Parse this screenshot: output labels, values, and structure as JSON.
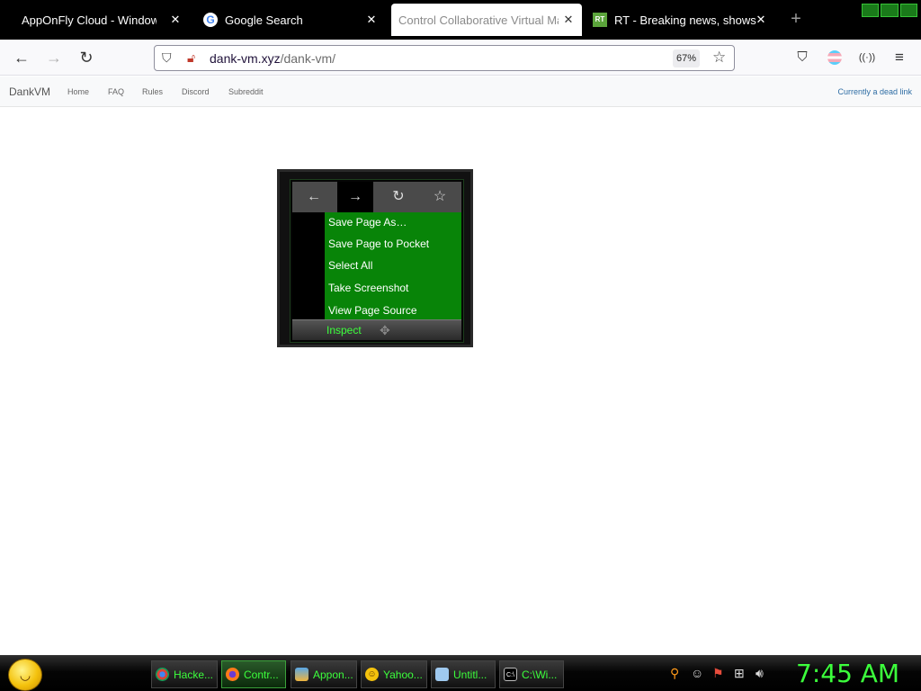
{
  "tabs": [
    {
      "title": "AppOnFly Cloud - Windows V",
      "close": "✕"
    },
    {
      "title": "Google Search",
      "close": "✕"
    },
    {
      "title": "Control Collaborative Virtual Mach",
      "close": "✕"
    },
    {
      "title": "RT - Breaking news, shows, po",
      "close": "✕",
      "favicon_text": "RT"
    }
  ],
  "new_tab": "+",
  "url": {
    "host": "dank-vm.xyz",
    "path": "/dank-vm/",
    "zoom": "67%"
  },
  "toolbar_icons": [
    "back-icon",
    "forward-icon",
    "reload-icon",
    "shield-icon",
    "lock-icon",
    "star-icon",
    "pocket-icon",
    "extension-icon",
    "menu-icon"
  ],
  "site_nav": {
    "brand": "DankVM",
    "links": [
      "Home",
      "FAQ",
      "Rules",
      "Discord",
      "Subreddit"
    ],
    "right_link": "Currently a dead link"
  },
  "vm_context_menu": {
    "items": [
      "Save Page As…",
      "Save Page to Pocket",
      "Select All",
      "Take Screenshot",
      "View Page Source"
    ],
    "hovered_item": "Inspect",
    "menu_color": "#088408"
  },
  "taskbar": {
    "tasks": [
      {
        "label": "Hacke...",
        "icon": "chrome-icon"
      },
      {
        "label": "Contr...",
        "icon": "firefox-icon"
      },
      {
        "label": "Appon...",
        "icon": "apponfly-icon"
      },
      {
        "label": "Yahoo...",
        "icon": "yahoo-icon"
      },
      {
        "label": "Untitl...",
        "icon": "notepad-icon"
      },
      {
        "label": "C:\\Wi...",
        "icon": "cmd-icon"
      }
    ],
    "clock": "7:45 AM",
    "accent_color": "#3cff3c"
  }
}
